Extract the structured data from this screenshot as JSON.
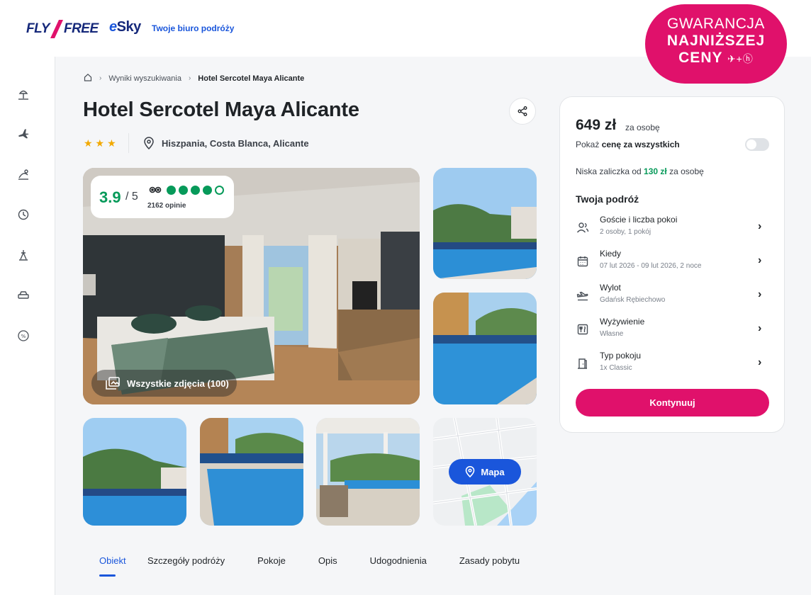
{
  "header": {
    "flyfree_logo": "FLY FREE",
    "esky_logo": "eSky",
    "tagline": "Twoje biuro podróży"
  },
  "badge": {
    "line1": "GWARANCJA",
    "line2": "NAJNIŻSZEJ",
    "line3": "CENY"
  },
  "sidebar": {
    "icons": [
      "beach-icon",
      "plane-icon",
      "plane-hotel-icon",
      "last-minute-icon",
      "ski-icon",
      "car-icon",
      "discount-icon"
    ]
  },
  "breadcrumb": {
    "home_icon": "home-icon",
    "item1": "Wyniki wyszukiwania",
    "current": "Hotel Sercotel Maya Alicante"
  },
  "hotel": {
    "title": "Hotel Sercotel Maya Alicante",
    "stars": "★★★",
    "star_count": 3,
    "location": "Hiszpania, Costa Blanca, Alicante"
  },
  "rating": {
    "score": "3.9",
    "of": "/ 5",
    "reviews": "2162 opinie",
    "bubbles_filled": 4,
    "bubbles_total": 5
  },
  "gallery": {
    "all_photos_label": "Wszystkie zdjęcia (100)",
    "map_label": "Mapa"
  },
  "tabs": [
    {
      "label": "Obiekt",
      "active": true
    },
    {
      "label": "Szczegóły podróży"
    },
    {
      "label": "Pokoje"
    },
    {
      "label": "Opis"
    },
    {
      "label": "Udogodnienia"
    },
    {
      "label": "Zasady pobytu"
    }
  ],
  "booking": {
    "price": "649 zł",
    "price_per": "za osobę",
    "show_all_prefix": "Pokaż ",
    "show_all_bold": "cenę za wszystkich",
    "toggle_on": false,
    "deposit_prefix": "Niska zaliczka od ",
    "deposit_amount": "130 zł",
    "deposit_suffix": " za osobę",
    "trip_title": "Twoja podróż",
    "rows": [
      {
        "label": "Goście i liczba pokoi",
        "value": "2 osoby, 1 pokój",
        "icon": "guests-icon"
      },
      {
        "label": "Kiedy",
        "value": "07 lut 2026 - 09 lut 2026, 2 noce",
        "icon": "calendar-icon"
      },
      {
        "label": "Wylot",
        "value": "Gdańsk Rębiechowo",
        "icon": "departure-icon"
      },
      {
        "label": "Wyżywienie",
        "value": "Własne",
        "icon": "meal-icon"
      },
      {
        "label": "Typ pokoju",
        "value": "1x Classic",
        "icon": "room-door-icon"
      }
    ],
    "continue_label": "Kontynuuj"
  },
  "colors": {
    "brand_pink": "#e0116b",
    "brand_blue": "#1a56db",
    "rating_green": "#079a5a",
    "star_gold": "#f2a900"
  }
}
